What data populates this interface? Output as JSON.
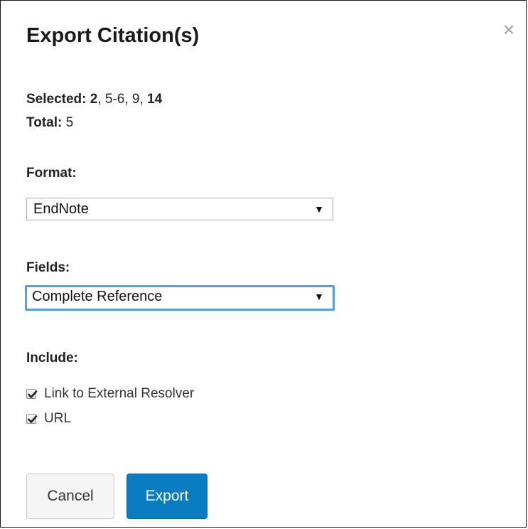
{
  "dialog": {
    "title": "Export Citation(s)",
    "close_symbol": "×",
    "selected_label": "Selected:",
    "selected_parts": [
      "2",
      ", 5-6, 9, ",
      "14"
    ],
    "total_label": "Total:",
    "total_value": "5",
    "format": {
      "label": "Format:",
      "selected": "EndNote"
    },
    "fields": {
      "label": "Fields:",
      "selected": "Complete Reference"
    },
    "include": {
      "label": "Include:",
      "options": [
        {
          "label": "Link to External Resolver",
          "checked": true
        },
        {
          "label": "URL",
          "checked": true
        }
      ]
    },
    "buttons": {
      "cancel": "Cancel",
      "export": "Export"
    }
  },
  "colors": {
    "primary": "#0a7cc2",
    "focus_border": "#5b9dd9"
  },
  "icons": {
    "close": "close-icon",
    "dropdown": "dropdown-arrow-icon",
    "check": "checkmark-icon"
  }
}
